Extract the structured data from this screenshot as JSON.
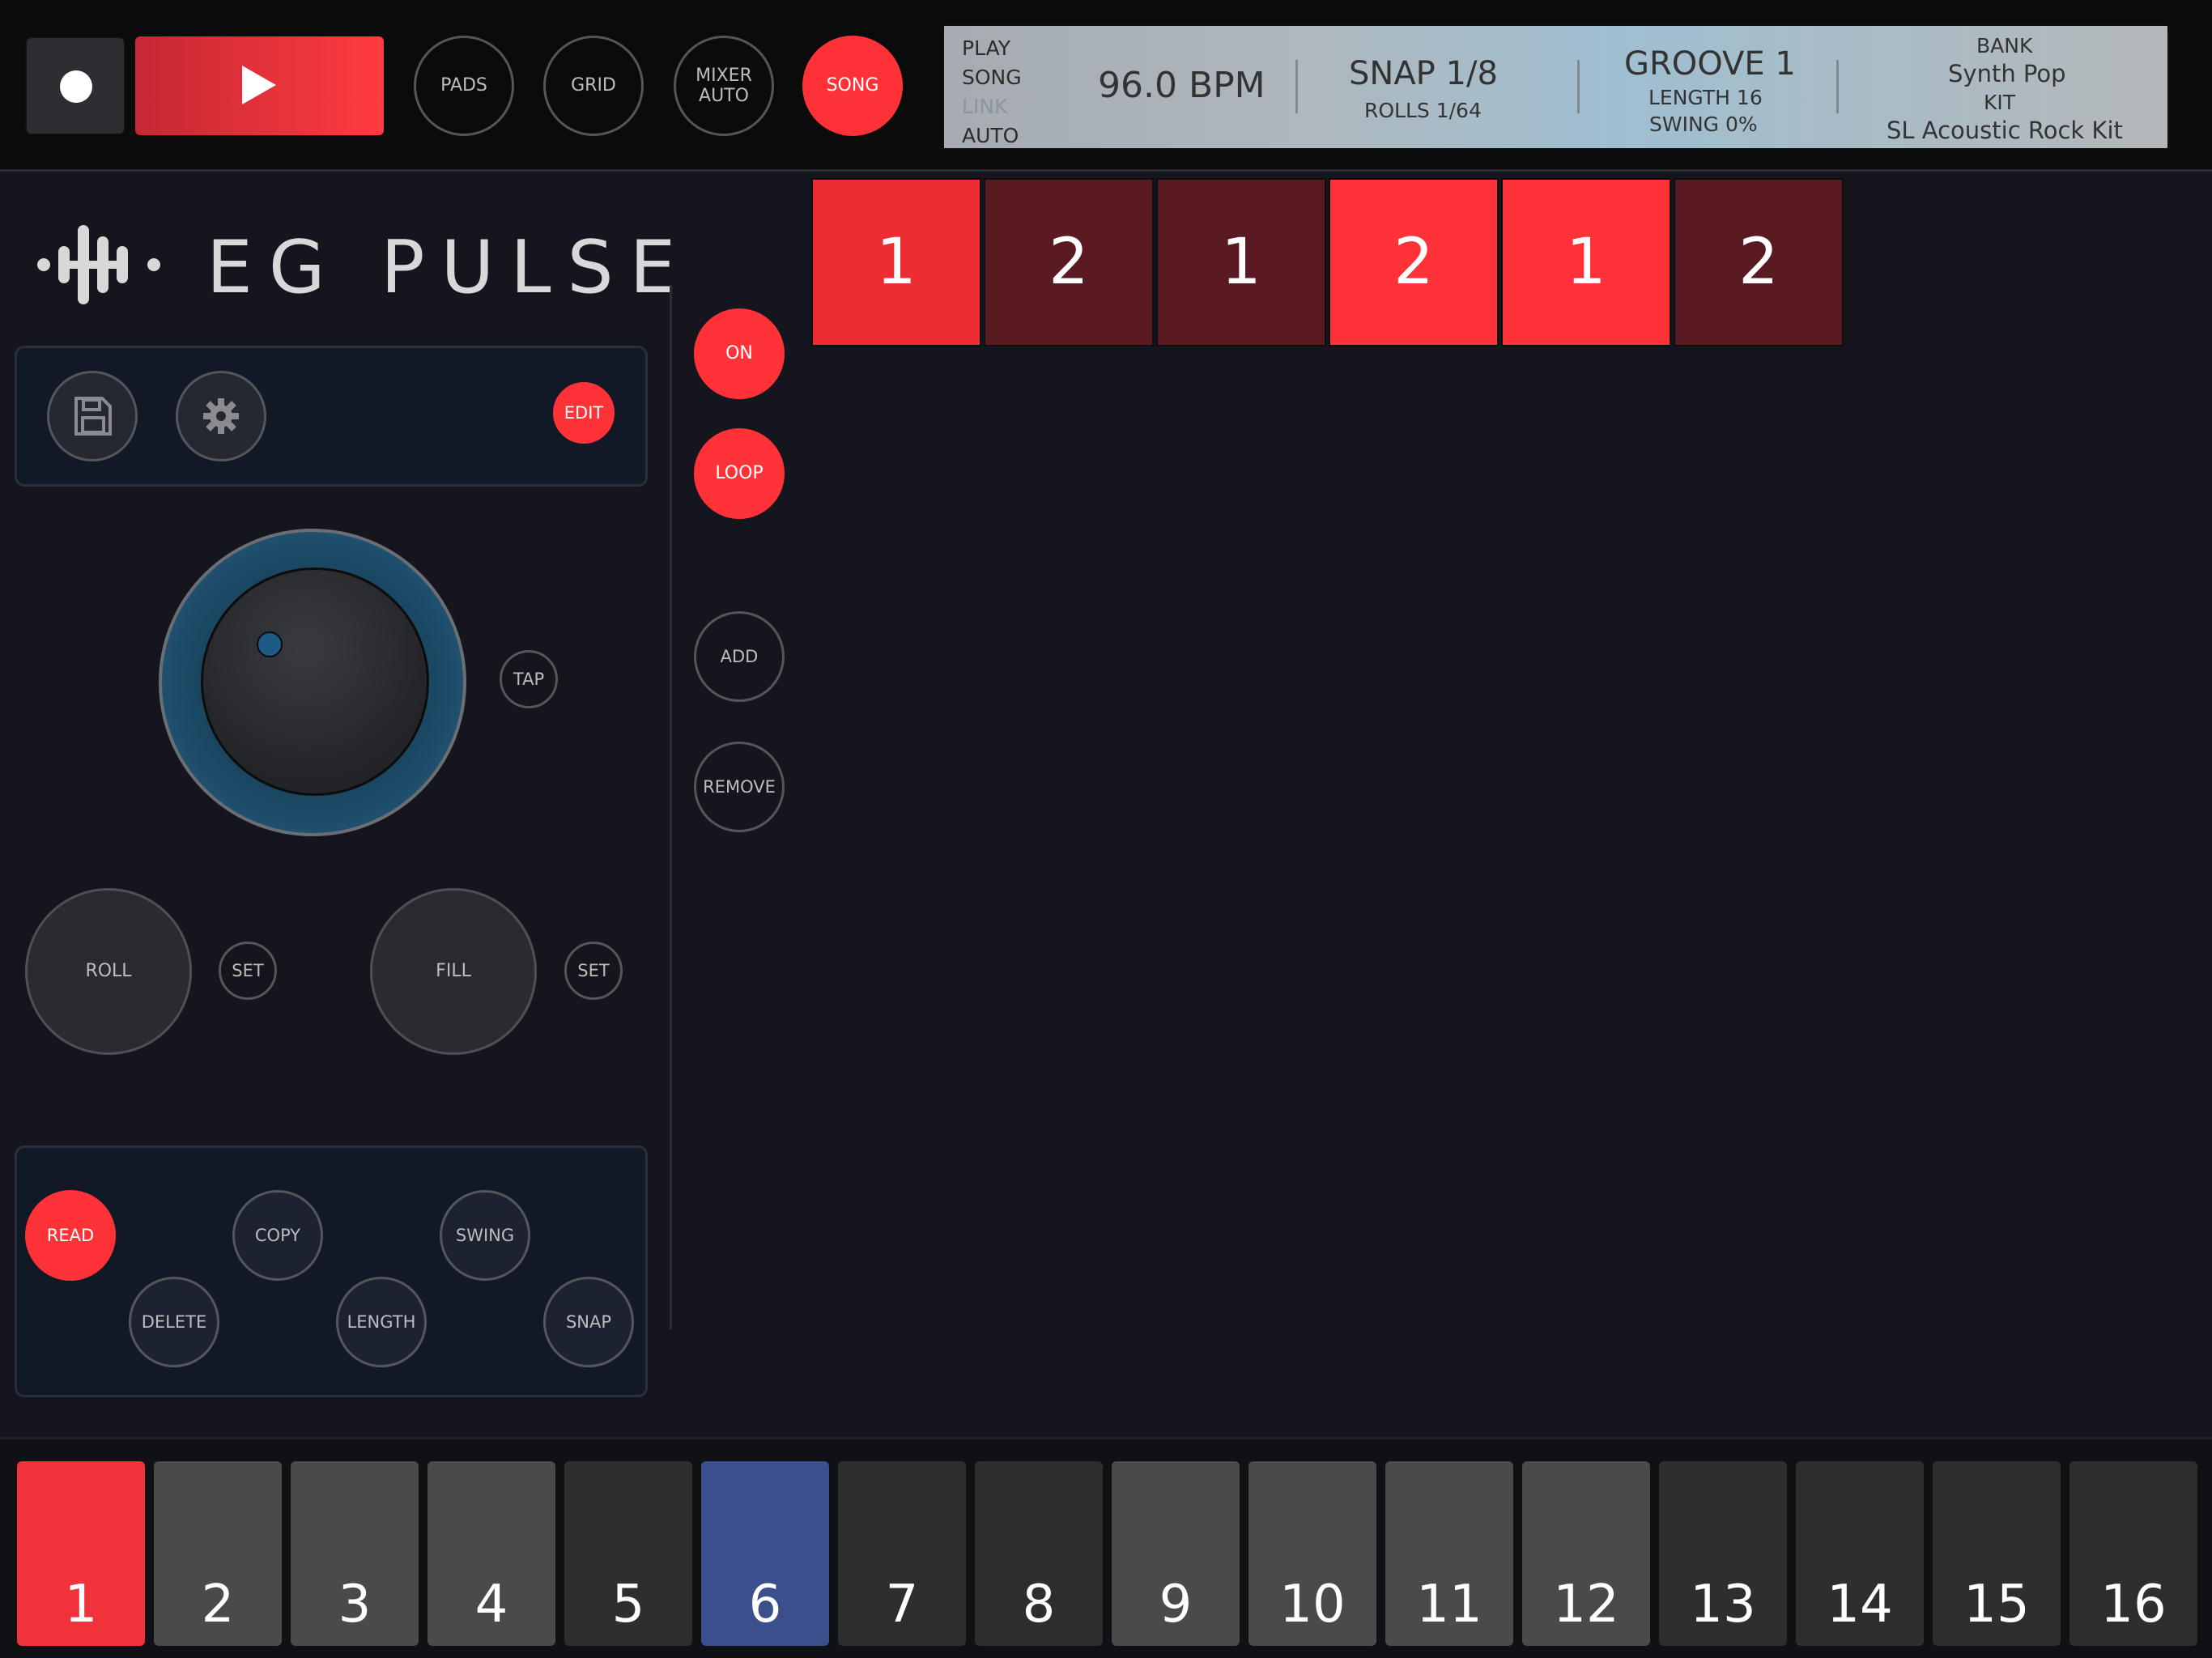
{
  "transport": {
    "record": "record-button",
    "play": "play-button"
  },
  "top_buttons": {
    "pads": "PADS",
    "grid": "GRID",
    "mixer_line1": "MIXER",
    "mixer_line2": "AUTO",
    "song": "SONG"
  },
  "lcd": {
    "modes": {
      "play": "PLAY",
      "song": "SONG",
      "link": "LINK",
      "auto": "AUTO"
    },
    "bpm": "96.0 BPM",
    "snap": "SNAP 1/8",
    "rolls": "ROLLS 1/64",
    "groove": "GROOVE 1",
    "length": "LENGTH 16",
    "swing": "SWING 0%",
    "bank_label": "BANK",
    "bank_value": "Synth Pop",
    "kit_label": "KIT",
    "kit_value": "SL Acoustic Rock Kit"
  },
  "logo": {
    "text": "EG PULSE"
  },
  "panel_top": {
    "edit": "EDIT"
  },
  "tempo": {
    "tap": "TAP"
  },
  "perform": {
    "roll": "ROLL",
    "roll_set": "SET",
    "fill": "FILL",
    "fill_set": "SET"
  },
  "pattern_edit": {
    "read": "READ",
    "copy": "COPY",
    "swing": "SWING",
    "delete": "DELETE",
    "length": "LENGTH",
    "snap": "SNAP"
  },
  "song_controls": {
    "on": "ON",
    "loop": "LOOP",
    "add": "ADD",
    "remove": "REMOVE"
  },
  "song_blocks": [
    {
      "label": "1",
      "color": "#ee2c34"
    },
    {
      "label": "2",
      "color": "#5a1a22"
    },
    {
      "label": "1",
      "color": "#5a1a22"
    },
    {
      "label": "2",
      "color": "#ff3238"
    },
    {
      "label": "1",
      "color": "#ff3238"
    },
    {
      "label": "2",
      "color": "#5a1a22"
    }
  ],
  "pads": [
    {
      "label": "1",
      "color": "#f2323a"
    },
    {
      "label": "2",
      "color": "#4a4a4c"
    },
    {
      "label": "3",
      "color": "#4a4a4c"
    },
    {
      "label": "4",
      "color": "#4a4a4c"
    },
    {
      "label": "5",
      "color": "#2e2e30"
    },
    {
      "label": "6",
      "color": "#3a4f8c"
    },
    {
      "label": "7",
      "color": "#2e2e30"
    },
    {
      "label": "8",
      "color": "#2e2e30"
    },
    {
      "label": "9",
      "color": "#4a4a4c"
    },
    {
      "label": "10",
      "color": "#4a4a4c"
    },
    {
      "label": "11",
      "color": "#4a4a4c"
    },
    {
      "label": "12",
      "color": "#4a4a4c"
    },
    {
      "label": "13",
      "color": "#2e2e30"
    },
    {
      "label": "14",
      "color": "#2e2e30"
    },
    {
      "label": "15",
      "color": "#2e2e30"
    },
    {
      "label": "16",
      "color": "#2e2e30"
    }
  ],
  "colors": {
    "accent": "#ff3238",
    "background": "#15161d",
    "lcd": "#a9bcc6"
  }
}
